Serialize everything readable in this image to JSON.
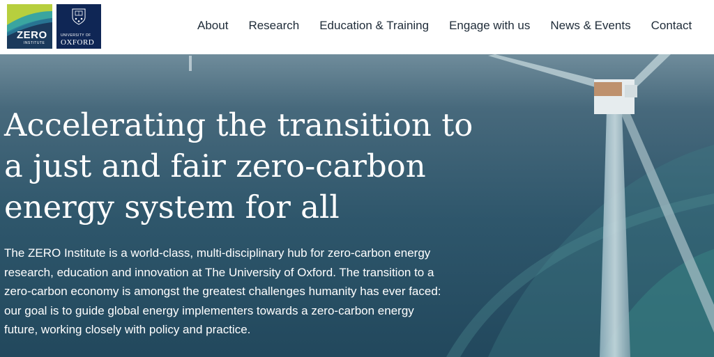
{
  "logos": {
    "zero": {
      "word": "ZERO",
      "sub": "INSTITUTE"
    },
    "oxford": {
      "university_of": "UNIVERSITY OF",
      "name": "OXFORD"
    }
  },
  "nav": {
    "items": [
      {
        "label": "About"
      },
      {
        "label": "Research"
      },
      {
        "label": "Education & Training"
      },
      {
        "label": "Engage with us"
      },
      {
        "label": "News & Events"
      },
      {
        "label": "Contact"
      }
    ]
  },
  "hero": {
    "title": "Accelerating the transition to a just and fair zero-carbon energy system for all",
    "description": "The ZERO Institute is a world-class, multi-disciplinary hub for zero-carbon energy research, education and innovation at The University of Oxford. The transition to a zero-carbon economy is amongst the greatest challenges humanity has ever faced: our goal is to guide global energy implementers towards a zero-carbon energy future, working closely with policy and practice."
  },
  "colors": {
    "oxford_blue": "#0f2655",
    "zero_navy": "#1b3a5c",
    "zero_lime": "#b7cf3e",
    "zero_teal": "#3aa5a0",
    "sea": "#2d5469"
  }
}
